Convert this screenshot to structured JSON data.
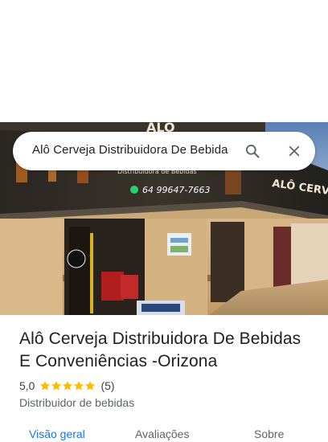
{
  "search": {
    "query": "Alô Cerveja Distribuidora De Bebida"
  },
  "photo": {
    "sign_top_text": "ALÔ",
    "sign_right_text": "ALÔ CERVEJA",
    "sign_sub_text": "Distribuidora de Bebidas",
    "sign_phone": "64 99647-7663"
  },
  "place": {
    "title": "Alô Cerveja Distribuidora De Bebidas E Conveniências -Orizona",
    "rating": "5,0",
    "stars_count": 5,
    "reviews": "(5)",
    "category": "Distribuidor de bebidas"
  },
  "tabs": [
    {
      "label": "Visão geral",
      "active": true
    },
    {
      "label": "Avaliações",
      "active": false
    },
    {
      "label": "Sobre",
      "active": false
    }
  ],
  "colors": {
    "accent": "#1a73e8",
    "star": "#fbbc04"
  }
}
